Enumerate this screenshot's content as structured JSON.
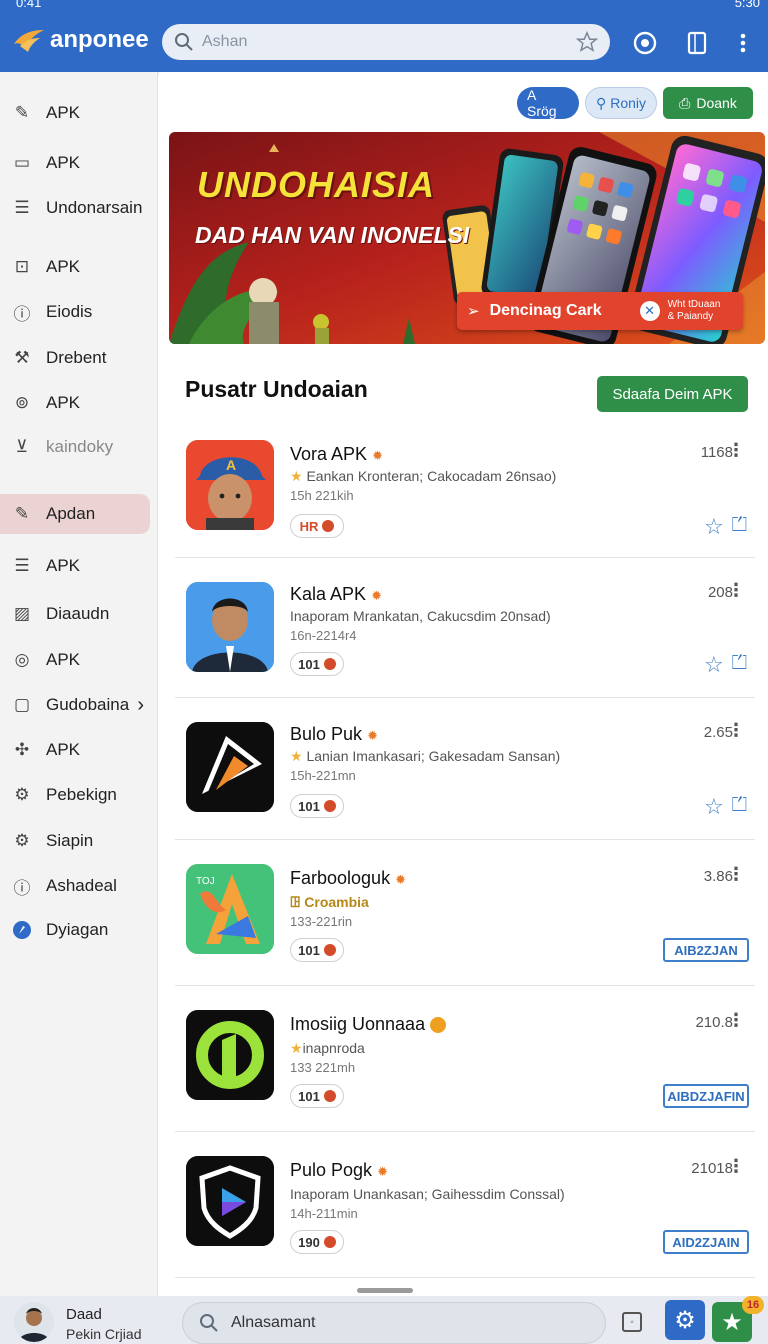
{
  "status_bar": {
    "time_left": "0:41",
    "time_right": "5:30"
  },
  "header": {
    "logo_text": "anponee",
    "search_placeholder": "Ashan",
    "icons": [
      "star-icon",
      "camera-icon",
      "tablet-icon",
      "more-vert-icon"
    ]
  },
  "sidebar": {
    "items": [
      {
        "label": "APK",
        "icon": "pin-icon"
      },
      {
        "label": "APK",
        "icon": "box-icon"
      },
      {
        "label": "Undonarsain",
        "icon": "list-icon"
      },
      {
        "label": "APK",
        "icon": "bag-icon"
      },
      {
        "label": "Eiodis",
        "icon": "info-icon"
      },
      {
        "label": "Drebent",
        "icon": "wrench-icon"
      },
      {
        "label": "APK",
        "icon": "badge-icon"
      },
      {
        "label": "kaindoky",
        "icon": "y-box-icon"
      },
      {
        "label": "Apdan",
        "icon": "pin-icon"
      },
      {
        "label": "APK",
        "icon": "list-icon"
      },
      {
        "label": "Diaaudn",
        "icon": "image-icon"
      },
      {
        "label": "APK",
        "icon": "circle-icon"
      },
      {
        "label": "Gudobaina",
        "icon": "folder-icon"
      },
      {
        "label": "APK",
        "icon": "puzzle-icon"
      },
      {
        "label": "Pebekign",
        "icon": "gear-icon"
      },
      {
        "label": "Siapin",
        "icon": "gear-icon"
      },
      {
        "label": "Ashadeal",
        "icon": "info-circle-icon"
      },
      {
        "label": "Dyiagan",
        "icon": "compass-icon"
      }
    ]
  },
  "toolbar": {
    "chips": [
      {
        "label": "A Srög"
      },
      {
        "label": "Roniy"
      },
      {
        "label": "Doank"
      }
    ]
  },
  "banner": {
    "title": "UNDOHAISIA",
    "subtitle": "DAD HAN VAN INONELSI",
    "cta": "Dencinag Cark",
    "side_text_1": "Wht tDuaan",
    "side_text_2": "& Paiandy"
  },
  "section": {
    "title": "Pusatr Undoaian",
    "button": "Sdaafa Deim APK"
  },
  "apps": [
    {
      "name": "Vora APK",
      "desc": "Eankan Kronteran; Cakocadam 26nsao)",
      "date": "15h 221kih",
      "badge": "HR",
      "count": "1168",
      "action": "icons"
    },
    {
      "name": "Kala APK",
      "desc": "Inaporam Mrankatan, Cakucsdim 20nsad)",
      "date": "16n-2214r4",
      "badge": "101",
      "count": "208",
      "action": "icons"
    },
    {
      "name": "Bulo Puk",
      "desc": "Lanian Imankasari; Gakesadam Sansan)",
      "date": "15h-221mn",
      "badge": "101",
      "count": "2.65",
      "action": "icons"
    },
    {
      "name": "Farboologuk",
      "desc": "Croambia",
      "date": "133-221rin",
      "badge": "101",
      "count": "3.86",
      "action": "AIB2ZJAN"
    },
    {
      "name": "Imosiig Uonnaaa",
      "desc": "inapnroda",
      "date": "133 221mh",
      "badge": "101",
      "count": "210.8",
      "action": "AIBDZJAFIN"
    },
    {
      "name": "Pulo Pogk",
      "desc": "Inaporam Unankasan; Gaihessdim Conssal)",
      "date": "14h-211min",
      "badge": "190",
      "count": "21018",
      "action": "AID2ZJAIN"
    }
  ],
  "footer": {
    "user_name": "Daad",
    "user_sub": "Pekin Crjiad",
    "search_placeholder": "Alnasamant",
    "notif_count": "16"
  }
}
